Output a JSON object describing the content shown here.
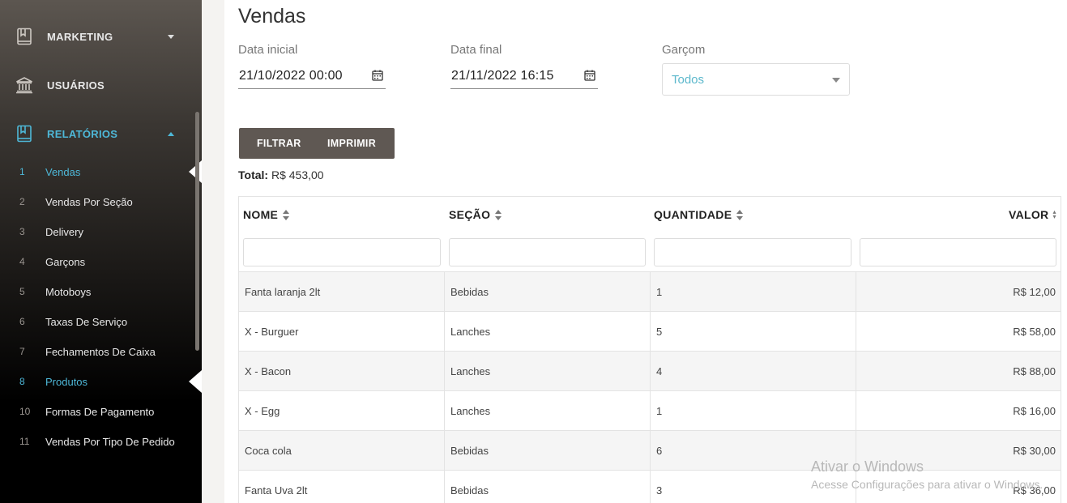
{
  "sidebar": {
    "sections": [
      {
        "label": "MARKETING",
        "icon": "book-icon",
        "caret": "down"
      },
      {
        "label": "USUÁRIOS",
        "icon": "bank-icon"
      },
      {
        "label": "RELATÓRIOS",
        "icon": "bookmark-book-icon",
        "caret": "up",
        "active": true
      }
    ],
    "items": [
      {
        "num": "1",
        "label": "Vendas",
        "active": true
      },
      {
        "num": "2",
        "label": "Vendas Por Seção"
      },
      {
        "num": "3",
        "label": "Delivery"
      },
      {
        "num": "4",
        "label": "Garçons"
      },
      {
        "num": "5",
        "label": "Motoboys"
      },
      {
        "num": "6",
        "label": "Taxas De Serviço"
      },
      {
        "num": "7",
        "label": "Fechamentos De Caixa"
      },
      {
        "num": "8",
        "label": "Produtos",
        "active": true
      },
      {
        "num": "10",
        "label": "Formas De Pagamento"
      },
      {
        "num": "11",
        "label": "Vendas Por Tipo De Pedido"
      }
    ],
    "accent_color": "#4eb8d8"
  },
  "page": {
    "title": "Vendas",
    "filters": {
      "start_label": "Data inicial",
      "start_value": "21/10/2022 00:00",
      "end_label": "Data final",
      "end_value": "21/11/2022 16:15",
      "waiter_label": "Garçom",
      "waiter_value": "Todos"
    },
    "buttons": {
      "filter": "FILTRAR",
      "print": "IMPRIMIR"
    },
    "total_label": "Total:",
    "total_value": "R$ 453,00"
  },
  "table": {
    "headers": [
      "NOME",
      "SEÇÃO",
      "QUANTIDADE",
      "VALOR"
    ],
    "rows": [
      [
        "Fanta laranja 2lt",
        "Bebidas",
        "1",
        "R$ 12,00"
      ],
      [
        "X - Burguer",
        "Lanches",
        "5",
        "R$ 58,00"
      ],
      [
        "X - Bacon",
        "Lanches",
        "4",
        "R$ 88,00"
      ],
      [
        "X - Egg",
        "Lanches",
        "1",
        "R$ 16,00"
      ],
      [
        "Coca cola",
        "Bebidas",
        "6",
        "R$ 30,00"
      ],
      [
        "Fanta Uva 2lt",
        "Bebidas",
        "3",
        "R$ 36,00"
      ]
    ]
  },
  "watermark": {
    "line1": "Ativar o Windows",
    "line2": "Acesse Configurações para ativar o Windows."
  }
}
